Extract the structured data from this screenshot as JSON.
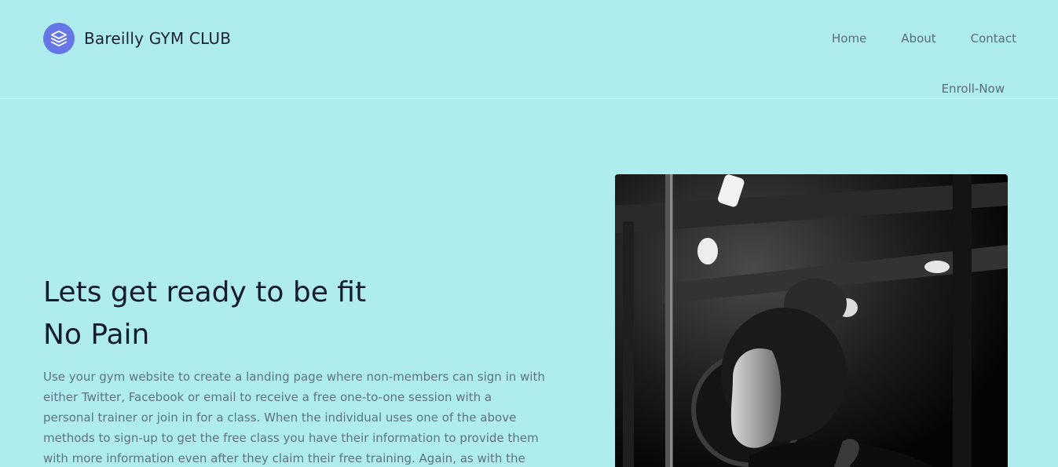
{
  "header": {
    "brand_name": "Bareilly GYM CLUB",
    "logo_icon": "stacked-layers-icon",
    "nav": [
      {
        "label": "Home"
      },
      {
        "label": "About"
      },
      {
        "label": "Contact"
      }
    ],
    "enroll_label": "Enroll-Now"
  },
  "hero": {
    "title_line1": "Lets get ready to be fit",
    "title_line2": "No Pain",
    "description": "Use your gym website to create a landing page where non-members can sign in with either Twitter, Facebook or email to receive a free one-to-one session with a personal trainer or join in for a class. When the individual uses one of the above methods to sign-up to get the free class you have their information to provide them with more information even after they claim their free training. Again, as with the",
    "image_subject": "woman-at-gym-photo"
  },
  "colors": {
    "background": "#aeecee",
    "accent": "#6576e6",
    "heading": "#151d2c",
    "body_text": "#5e7386",
    "nav_text": "#5b6b7a"
  }
}
